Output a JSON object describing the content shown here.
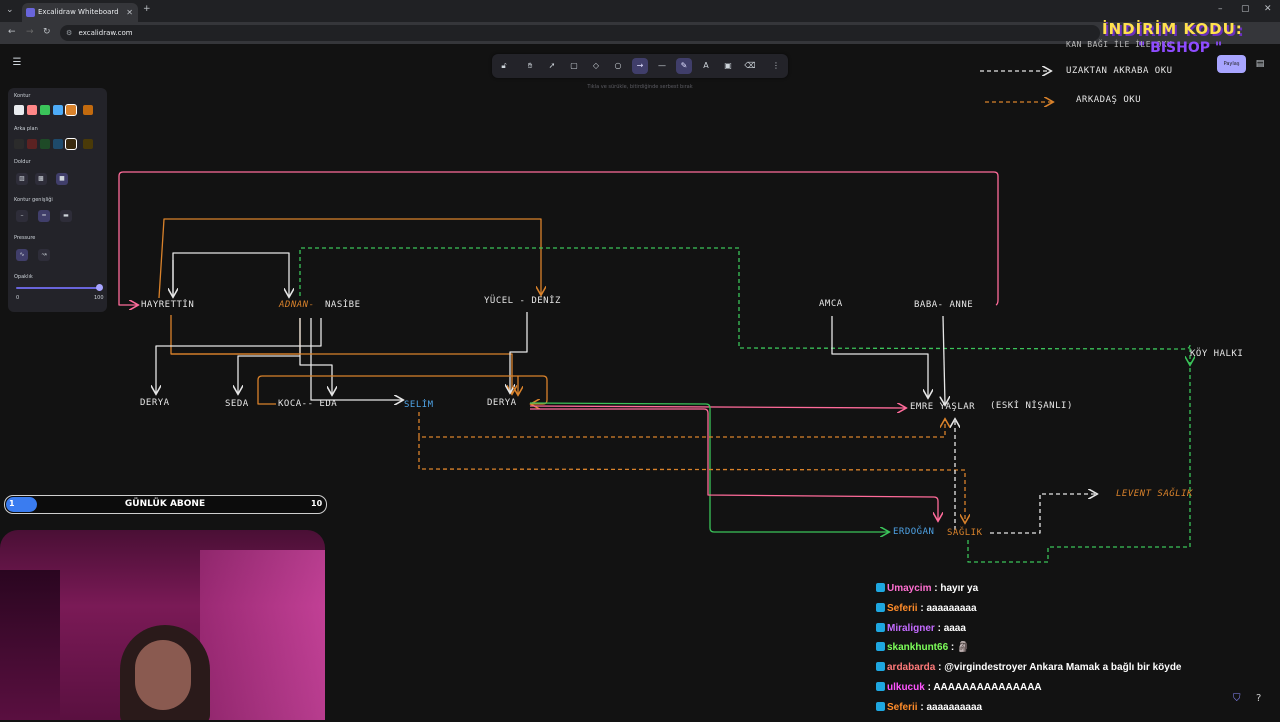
{
  "browser": {
    "tab_title": "Excalidraw Whiteboard",
    "new_tab": "+",
    "url": "excalidraw.com"
  },
  "toolbar": {
    "hint": "Tıkla ve sürükle, bitirdiğinde serbest bırak"
  },
  "panel": {
    "stroke_label": "Kontur",
    "bg_label": "Arka plan",
    "fill_label": "Doldur",
    "stroke_width_label": "Kontur genişliği",
    "pressure_label": "Pressure",
    "opacity_label": "Opaklık",
    "opacity_min": "0",
    "opacity_max": "100",
    "stroke_colors": [
      "#e9ecef",
      "#ff8787",
      "#3bc45a",
      "#4dabf7",
      "#d9822b",
      "#c26a0e"
    ],
    "bg_colors": [
      "#2b2b2b",
      "#5c2222",
      "#1e4a27",
      "#1e4a6b",
      "#3a2a0e",
      "#4a3a08"
    ]
  },
  "topright": {
    "share": "Paylaş",
    "promo_line1": "İNDİRİM KODU:",
    "promo_line2": "\" BISHOP \""
  },
  "legend": {
    "partial_text": "KAN BAĞI İLE İLE OKU",
    "distant": "UZAKTAN AKRABA OKU",
    "friend": "ARKADAŞ OKU"
  },
  "diagram": {
    "hayrettin": "HAYRETTİN",
    "adnan": "ADNAN-",
    "nasibe": "NASİBE",
    "yucel": "YÜCEL - DENİZ",
    "amca": "AMCA",
    "baba_anne": "BABA- ANNE",
    "koy_halki": "KÖY HALKI",
    "derya1": "DERYA",
    "seda": "SEDA",
    "koca_eda": "KOCA-- EDA",
    "selim": "SELİM",
    "derya2": "DERYA",
    "emre": "EMRE YAŞLAR",
    "eski": "(ESKİ NİŞANLI)",
    "levent": "LEVENT SAĞLIK",
    "erdogan": "ERDOĞAN",
    "saglik": "SAĞLIK"
  },
  "sub_goal": {
    "current": "1",
    "title": "GÜNLÜK ABONE",
    "target": "10"
  },
  "chat": [
    {
      "user": "Umaycim",
      "color": "#ff6fd1",
      "msg": "hayır ya"
    },
    {
      "user": "Seferii",
      "color": "#ff8c2a",
      "msg": "aaaaaaaaa"
    },
    {
      "user": "Miraligner",
      "color": "#c46bff",
      "msg": "aaaa"
    },
    {
      "user": "skankhunt66",
      "color": "#7dff5a",
      "msg": "🗿"
    },
    {
      "user": "ardabarda",
      "color": "#ff7a7a",
      "msg": "@virgindestroyer Ankara Mamak a bağlı bir köyde"
    },
    {
      "user": "ulkucuk",
      "color": "#ff55ff",
      "msg": "AAAAAAAAAAAAAAA"
    },
    {
      "user": "Seferii",
      "color": "#ff8c2a",
      "msg": "aaaaaaaaaa"
    }
  ]
}
